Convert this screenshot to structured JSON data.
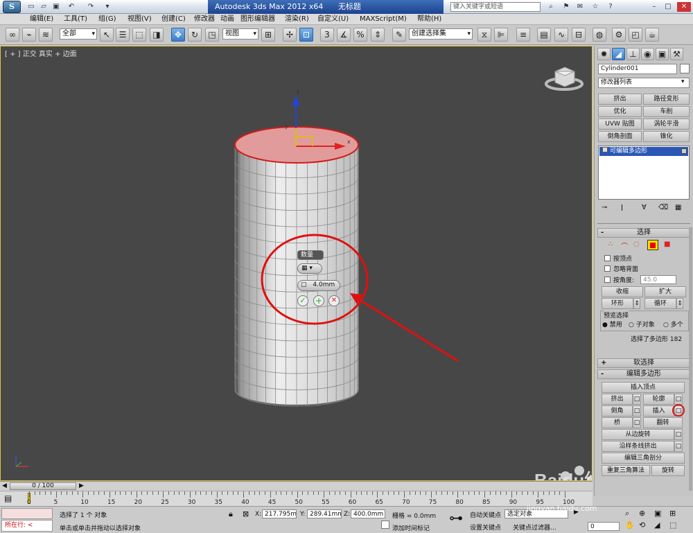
{
  "titlebar": {
    "title": "Autodesk 3ds Max  2012 x64",
    "filename": "无标题",
    "search_placeholder": "键入关键字或短语"
  },
  "menu": [
    "编辑(E)",
    "工具(T)",
    "组(G)",
    "视图(V)",
    "创建(C)",
    "修改器",
    "动画",
    "图形编辑器",
    "渲染(R)",
    "自定义(U)",
    "MAXScript(M)",
    "帮助(H)"
  ],
  "toolbar": {
    "selection_filter": "全部",
    "ref_coord": "视图",
    "named_selection": "创建选择集",
    "angle_snap_label": "3"
  },
  "viewport": {
    "label": "[ + ] 正交 ] 真实 + 边面 ]",
    "label_parts": [
      "[ + ]",
      "正交",
      "真实 + 边面"
    ],
    "gizmo_axes": [
      "x",
      "y",
      "z"
    ],
    "caddy_title": "数量",
    "caddy_value": "4.0mm"
  },
  "cmdpanel": {
    "object_name": "Cylinder001",
    "modifier_list": "修改器列表",
    "buttons": [
      [
        "挤出",
        "路径变形"
      ],
      [
        "优化",
        "车削"
      ],
      [
        "UVW 贴图",
        "涡轮平滑"
      ],
      [
        "倒角剖面",
        "锥化"
      ]
    ],
    "stack_item": "可编辑多边形",
    "selection_rollout": "选择",
    "by_vertex": "按顶点",
    "ignore_backfacing": "忽略背面",
    "by_angle": "按角度:",
    "angle_value": "45.0",
    "shrink": "收缩",
    "grow": "扩大",
    "ring": "环形",
    "loop": "循环",
    "preview_title": "预览选择",
    "preview_options": [
      "禁用",
      "子对象",
      "多个"
    ],
    "selected_text": "选择了多边形 182",
    "soft_selection": "软选择",
    "edit_polygons": "编辑多边形",
    "insert_vertex": "插入顶点",
    "extrude": "挤出",
    "outline": "轮廓",
    "bevel": "倒角",
    "inset": "插入",
    "bridge": "桥",
    "flip": "翻转",
    "hinge_from_edge": "从边旋转",
    "extrude_along_spline": "沿样条线挤出",
    "edit_triangulation": "编辑三角剖分",
    "retriangulate": "重复三角算法",
    "turn": "旋转"
  },
  "timeline": {
    "frame_display": "0 / 100",
    "ticks": [
      "0",
      "5",
      "10",
      "15",
      "20",
      "25",
      "30",
      "35",
      "40",
      "45",
      "50",
      "55",
      "60",
      "65",
      "70",
      "75",
      "80",
      "85",
      "90",
      "95",
      "100"
    ]
  },
  "status": {
    "running": "所在行:",
    "selected": "选择了 1 个 对象",
    "prompt": "单击或单击并拖动以选择对象",
    "x_label": "X:",
    "x": "217.795mr",
    "y_label": "Y:",
    "y": "289.41mm",
    "z_label": "Z:",
    "z": "400.0mm",
    "grid": "栅格 = 0.0mm",
    "add_time_tag": "添加时间标记",
    "auto_key": "自动关键点",
    "set_key": "设置关键点",
    "selected_object": "选定对象",
    "key_filters": "关键点过滤器...",
    "frame": "0"
  },
  "watermark": {
    "brand": "Baidu",
    "text": "经验",
    "url": "jingyan.baidu.com"
  }
}
